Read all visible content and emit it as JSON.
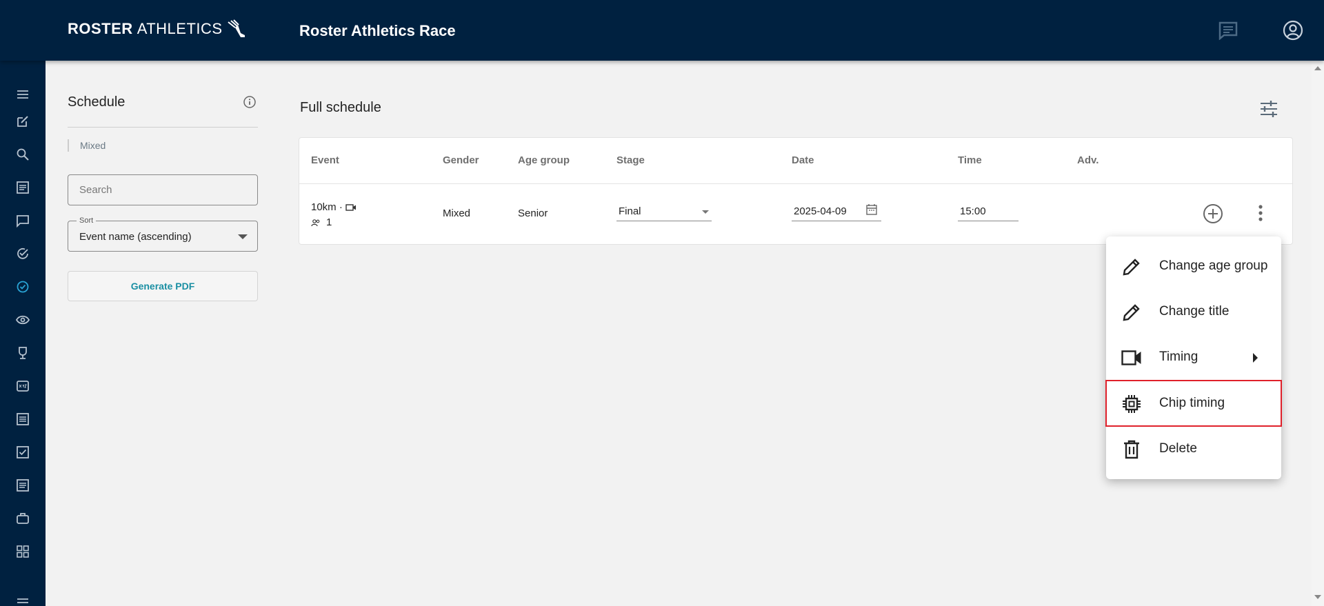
{
  "app": {
    "logo_bold": "ROSTER",
    "logo_light": "ATHLETICS",
    "title": "Roster Athletics Race"
  },
  "topbar_icons": [
    "chat-icon",
    "account-circle-icon"
  ],
  "rail_icons": [
    "menu-icon",
    "edit-icon",
    "search-icon",
    "article-icon",
    "chat-icon",
    "check-circle-icon",
    "schedule-check-icon",
    "eye-icon",
    "trophy-icon",
    "xyz-icon",
    "list-icon",
    "checkbox-icon",
    "document-icon",
    "briefcase-icon",
    "grid-icon",
    "menu-bottom-icon"
  ],
  "schedule_panel": {
    "title": "Schedule",
    "filter_chip": "Mixed",
    "search_placeholder": "Search",
    "sort_label": "Sort",
    "sort_value": "Event name (ascending)",
    "pdf_button": "Generate PDF"
  },
  "main": {
    "title": "Full schedule",
    "columns": [
      "Event",
      "Gender",
      "Age group",
      "Stage",
      "Date",
      "Time",
      "Adv."
    ],
    "rows": [
      {
        "event": "10km ·",
        "participants": "1",
        "gender": "Mixed",
        "age_group": "Senior",
        "stage": "Final",
        "date": "2025-04-09",
        "time": "15:00"
      }
    ]
  },
  "context_menu": {
    "items": [
      {
        "label": "Change age group",
        "icon": "pencil-icon"
      },
      {
        "label": "Change title",
        "icon": "pencil-icon"
      },
      {
        "label": "Timing",
        "icon": "video-camera-icon",
        "submenu": true
      },
      {
        "label": "Chip timing",
        "icon": "chip-icon",
        "highlighted": true
      },
      {
        "label": "Delete",
        "icon": "trash-icon"
      }
    ]
  },
  "colors": {
    "nav_bg": "#002140",
    "accent": "#1a8fa3",
    "highlight_border": "#e0202a",
    "page_bg": "#f2f2f2"
  }
}
